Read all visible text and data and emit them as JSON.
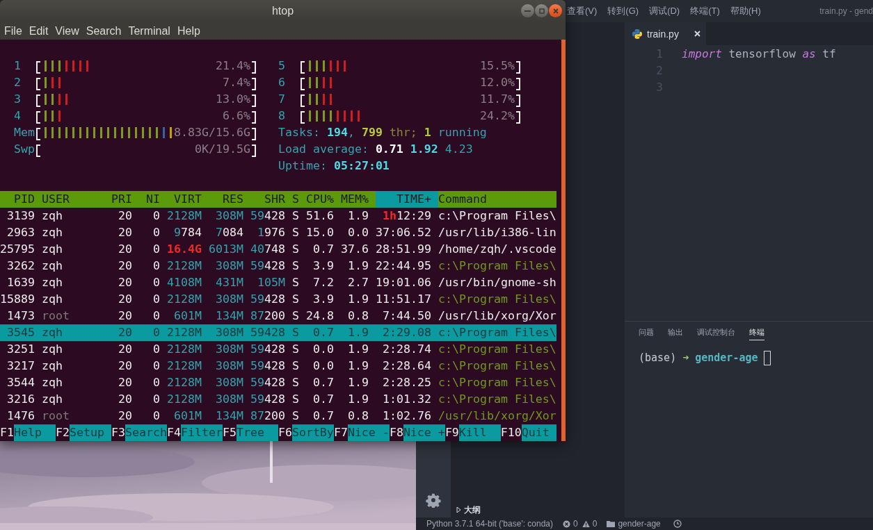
{
  "htop": {
    "title": "htop",
    "menu": [
      "File",
      "Edit",
      "View",
      "Search",
      "Terminal",
      "Help"
    ],
    "cpu_meters": [
      {
        "label": "1",
        "value": "21.4%",
        "bars": [
          {
            "color": "#7d9c1a"
          },
          {
            "color": "#7d9c1a"
          },
          {
            "color": "#7d9c1a"
          },
          {
            "color": "#cc1f1f"
          },
          {
            "color": "#cc1f1f"
          },
          {
            "color": "#cc1f1f"
          },
          {
            "color": "#cc1f1f"
          }
        ]
      },
      {
        "label": "2",
        "value": "7.4%",
        "bars": [
          {
            "color": "#7d9c1a"
          },
          {
            "color": "#cc1f1f"
          },
          {
            "color": "#cc1f1f"
          }
        ]
      },
      {
        "label": "3",
        "value": "13.0%",
        "bars": [
          {
            "color": "#7d9c1a"
          },
          {
            "color": "#7d9c1a"
          },
          {
            "color": "#cc1f1f"
          },
          {
            "color": "#cc1f1f"
          }
        ]
      },
      {
        "label": "4",
        "value": "6.6%",
        "bars": [
          {
            "color": "#7d9c1a"
          },
          {
            "color": "#7d9c1a"
          },
          {
            "color": "#cc1f1f"
          }
        ]
      },
      {
        "label": "5",
        "value": "15.5%",
        "bars": [
          {
            "color": "#7d9c1a"
          },
          {
            "color": "#7d9c1a"
          },
          {
            "color": "#7d9c1a"
          },
          {
            "color": "#cc1f1f"
          },
          {
            "color": "#cc1f1f"
          },
          {
            "color": "#cc1f1f"
          }
        ]
      },
      {
        "label": "6",
        "value": "12.0%",
        "bars": [
          {
            "color": "#7d9c1a"
          },
          {
            "color": "#7d9c1a"
          },
          {
            "color": "#cc1f1f"
          },
          {
            "color": "#cc1f1f"
          }
        ]
      },
      {
        "label": "7",
        "value": "11.7%",
        "bars": [
          {
            "color": "#7d9c1a"
          },
          {
            "color": "#7d9c1a"
          },
          {
            "color": "#cc1f1f"
          },
          {
            "color": "#cc1f1f"
          }
        ]
      },
      {
        "label": "8",
        "value": "24.2%",
        "bars": [
          {
            "color": "#7d9c1a"
          },
          {
            "color": "#7d9c1a"
          },
          {
            "color": "#7d9c1a"
          },
          {
            "color": "#7d9c1a"
          },
          {
            "color": "#cc1f1f"
          },
          {
            "color": "#cc1f1f"
          },
          {
            "color": "#cc1f1f"
          },
          {
            "color": "#cc1f1f"
          }
        ]
      }
    ],
    "memory_meters": [
      {
        "label": "Mem",
        "value": "8.83G/15.6G",
        "bars": [
          {
            "color": "#7d9c1a"
          },
          {
            "color": "#7d9c1a"
          },
          {
            "color": "#7d9c1a"
          },
          {
            "color": "#7d9c1a"
          },
          {
            "color": "#7d9c1a"
          },
          {
            "color": "#7d9c1a"
          },
          {
            "color": "#7d9c1a"
          },
          {
            "color": "#7d9c1a"
          },
          {
            "color": "#7d9c1a"
          },
          {
            "color": "#7d9c1a"
          },
          {
            "color": "#7d9c1a"
          },
          {
            "color": "#7d9c1a"
          },
          {
            "color": "#7d9c1a"
          },
          {
            "color": "#7d9c1a"
          },
          {
            "color": "#7d9c1a"
          },
          {
            "color": "#7d9c1a"
          },
          {
            "color": "#7d9c1a"
          },
          {
            "color": "#3465a4"
          },
          {
            "color": "#c4a000"
          }
        ]
      },
      {
        "label": "Swp",
        "value": "0K/19.5G"
      }
    ],
    "tasks": [
      {
        "text": "Tasks: ",
        "kind": "label"
      },
      {
        "text": "194",
        "kind": "highlight"
      },
      {
        "text": ", ",
        "kind": "label"
      },
      {
        "text": "799",
        "kind": "threads"
      },
      {
        "text": " thr; ",
        "kind": "threads_label"
      },
      {
        "text": "1",
        "kind": "running"
      },
      {
        "text": " running",
        "kind": "label"
      }
    ],
    "load_average": [
      {
        "text": "Load average: ",
        "kind": "label"
      },
      {
        "text": "0.71",
        "kind": "strong"
      },
      {
        "text": " 1.92",
        "kind": "highlight"
      },
      {
        "text": " 4.23",
        "kind": "label"
      }
    ],
    "uptime": [
      {
        "text": "Uptime: ",
        "kind": "label"
      },
      {
        "text": "05:27:01",
        "kind": "highlight"
      }
    ],
    "process_table": {
      "columns": [
        {
          "label": "PID",
          "sorted": false
        },
        {
          "label": "USER",
          "sorted": false
        },
        {
          "label": "PRI",
          "sorted": false
        },
        {
          "label": "NI",
          "sorted": false
        },
        {
          "label": "VIRT",
          "sorted": false
        },
        {
          "label": "RES",
          "sorted": false
        },
        {
          "label": "SHR",
          "sorted": false
        },
        {
          "label": "S",
          "sorted": false
        },
        {
          "label": "CPU%",
          "sorted": false
        },
        {
          "label": "MEM%",
          "sorted": false
        },
        {
          "label": "TIME+",
          "sorted": true
        },
        {
          "label": "Command",
          "sorted": false
        }
      ],
      "rows": [
        {
          "pid": "3139",
          "user": "zqh",
          "dimmed_user": false,
          "pri": "20",
          "ni": "0",
          "virt": "2128M",
          "res": "308M",
          "shr": "59428",
          "state": "S",
          "cpu": "51.6",
          "mem": "1.9",
          "time": "1h12:29",
          "command": "c:\\Program Files\\",
          "thread": false,
          "selected": false
        },
        {
          "pid": "2963",
          "user": "zqh",
          "dimmed_user": false,
          "pri": "20",
          "ni": "0",
          "virt": "9784",
          "res": "7084",
          "shr": "1976",
          "state": "S",
          "cpu": "15.0",
          "mem": "0.0",
          "time": "37:06.52",
          "command": "/usr/lib/i386-lin",
          "thread": false,
          "selected": false
        },
        {
          "pid": "25795",
          "user": "zqh",
          "dimmed_user": false,
          "pri": "20",
          "ni": "0",
          "virt": "16.4G",
          "res": "6013M",
          "shr": "40748",
          "state": "S",
          "cpu": "0.7",
          "mem": "37.6",
          "time": "28:51.99",
          "command": "/home/zqh/.vscode",
          "thread": false,
          "selected": false
        },
        {
          "pid": "3262",
          "user": "zqh",
          "dimmed_user": false,
          "pri": "20",
          "ni": "0",
          "virt": "2128M",
          "res": "308M",
          "shr": "59428",
          "state": "S",
          "cpu": "3.9",
          "mem": "1.9",
          "time": "22:44.95",
          "command": "c:\\Program Files\\",
          "thread": true,
          "selected": false
        },
        {
          "pid": "1639",
          "user": "zqh",
          "dimmed_user": false,
          "pri": "20",
          "ni": "0",
          "virt": "4108M",
          "res": "431M",
          "shr": "105M",
          "state": "S",
          "cpu": "7.2",
          "mem": "2.7",
          "time": "19:01.06",
          "command": "/usr/bin/gnome-sh",
          "thread": false,
          "selected": false
        },
        {
          "pid": "15889",
          "user": "zqh",
          "dimmed_user": false,
          "pri": "20",
          "ni": "0",
          "virt": "2128M",
          "res": "308M",
          "shr": "59428",
          "state": "S",
          "cpu": "3.9",
          "mem": "1.9",
          "time": "11:51.17",
          "command": "c:\\Program Files\\",
          "thread": true,
          "selected": false
        },
        {
          "pid": "1473",
          "user": "root",
          "dimmed_user": true,
          "pri": "20",
          "ni": "0",
          "virt": "601M",
          "res": "134M",
          "shr": "87200",
          "state": "S",
          "cpu": "24.8",
          "mem": "0.8",
          "time": "7:44.50",
          "command": "/usr/lib/xorg/Xor",
          "thread": false,
          "selected": false
        },
        {
          "pid": "3545",
          "user": "zqh",
          "dimmed_user": false,
          "pri": "20",
          "ni": "0",
          "virt": "2128M",
          "res": "308M",
          "shr": "59428",
          "state": "S",
          "cpu": "0.7",
          "mem": "1.9",
          "time": "2:29.08",
          "command": "c:\\Program Files\\",
          "thread": true,
          "selected": true
        },
        {
          "pid": "3251",
          "user": "zqh",
          "dimmed_user": false,
          "pri": "20",
          "ni": "0",
          "virt": "2128M",
          "res": "308M",
          "shr": "59428",
          "state": "S",
          "cpu": "0.0",
          "mem": "1.9",
          "time": "2:28.74",
          "command": "c:\\Program Files\\",
          "thread": true,
          "selected": false
        },
        {
          "pid": "3217",
          "user": "zqh",
          "dimmed_user": false,
          "pri": "20",
          "ni": "0",
          "virt": "2128M",
          "res": "308M",
          "shr": "59428",
          "state": "S",
          "cpu": "0.0",
          "mem": "1.9",
          "time": "2:28.64",
          "command": "c:\\Program Files\\",
          "thread": true,
          "selected": false
        },
        {
          "pid": "3544",
          "user": "zqh",
          "dimmed_user": false,
          "pri": "20",
          "ni": "0",
          "virt": "2128M",
          "res": "308M",
          "shr": "59428",
          "state": "S",
          "cpu": "0.7",
          "mem": "1.9",
          "time": "2:28.25",
          "command": "c:\\Program Files\\",
          "thread": true,
          "selected": false
        },
        {
          "pid": "3216",
          "user": "zqh",
          "dimmed_user": false,
          "pri": "20",
          "ni": "0",
          "virt": "2128M",
          "res": "308M",
          "shr": "59428",
          "state": "S",
          "cpu": "0.7",
          "mem": "1.9",
          "time": "1:01.32",
          "command": "c:\\Program Files\\",
          "thread": true,
          "selected": false
        },
        {
          "pid": "1476",
          "user": "root",
          "dimmed_user": true,
          "pri": "20",
          "ni": "0",
          "virt": "601M",
          "res": "134M",
          "shr": "87200",
          "state": "S",
          "cpu": "0.7",
          "mem": "0.8",
          "time": "1:02.76",
          "command": "/usr/lib/xorg/Xor",
          "thread": true,
          "selected": false
        }
      ]
    },
    "function_keys": [
      {
        "key": "F1",
        "label": "Help"
      },
      {
        "key": "F2",
        "label": "Setup"
      },
      {
        "key": "F3",
        "label": "Search"
      },
      {
        "key": "F4",
        "label": "Filter"
      },
      {
        "key": "F5",
        "label": "Tree"
      },
      {
        "key": "F6",
        "label": "SortBy"
      },
      {
        "key": "F7",
        "label": "Nice -"
      },
      {
        "key": "F8",
        "label": "Nice +"
      },
      {
        "key": "F9",
        "label": "Kill"
      },
      {
        "key": "F10",
        "label": "Quit"
      }
    ]
  },
  "editor_window": {
    "menu": [
      "查看(V)",
      "转到(G)",
      "调试(D)",
      "终端(T)",
      "帮助(H)"
    ],
    "title": "train.py - gend",
    "tabs": [
      {
        "label": "train.py",
        "selected": true
      }
    ],
    "code_lines": [
      {
        "number": "1",
        "tokens": [
          {
            "text": "import",
            "kind": "keyword"
          },
          {
            "text": " tensorflow ",
            "kind": "plain"
          },
          {
            "text": "as",
            "kind": "keyword"
          },
          {
            "text": " tf",
            "kind": "plain"
          }
        ]
      },
      {
        "number": "2"
      },
      {
        "number": "3"
      }
    ],
    "panel_tabs": [
      {
        "label": "问题",
        "selected": false
      },
      {
        "label": "输出",
        "selected": false
      },
      {
        "label": "调试控制台",
        "selected": false
      },
      {
        "label": "终端",
        "selected": true
      }
    ],
    "terminal_prompt": [
      {
        "text": "(base)",
        "kind": "plain"
      },
      {
        "text": "➜",
        "kind": "arrow"
      },
      {
        "text": "gender-age",
        "kind": "directory"
      }
    ],
    "outline_section": {
      "label": "大纲",
      "expanded": false
    },
    "status_bar": {
      "interpreter": "Python 3.7.1 64-bit ('base': conda)",
      "errors": "0",
      "warnings": "0",
      "folder": "gender-age"
    }
  }
}
